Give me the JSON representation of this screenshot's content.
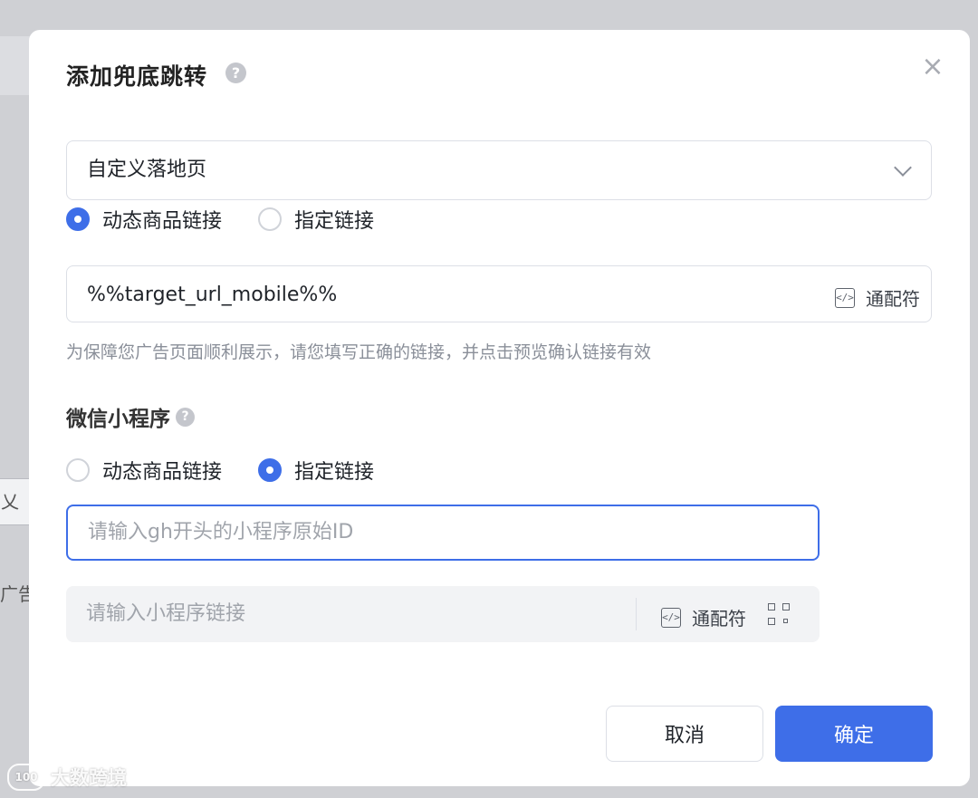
{
  "dialog": {
    "title": "添加兜底跳转",
    "help_glyph": "?",
    "close_glyph": "×"
  },
  "landing_select": {
    "value": "自定义落地页"
  },
  "h5_link_type": {
    "options": [
      {
        "label": "动态商品链接",
        "selected": true
      },
      {
        "label": "指定链接",
        "selected": false
      }
    ]
  },
  "url_input": {
    "value": "%%target_url_mobile%%",
    "wildcard_label": "通配符",
    "code_glyph": "</>"
  },
  "hint": "为保障您广告页面顺利展示，请您填写正确的链接，并点击预览确认链接有效",
  "mini_program": {
    "section_title": "微信小程序",
    "options": [
      {
        "label": "动态商品链接",
        "selected": false
      },
      {
        "label": "指定链接",
        "selected": true
      }
    ],
    "appid_placeholder": "请输入gh开头的小程序原始ID",
    "link_placeholder": "请输入小程序链接",
    "wildcard_label": "通配符"
  },
  "buttons": {
    "cancel": "取消",
    "confirm": "确定"
  },
  "background": {
    "card_text": "乂",
    "side_text": "广告"
  },
  "watermark": {
    "logo_text": "100",
    "text": "大数跨境"
  },
  "colors": {
    "primary": "#3e6ee8",
    "placeholder": "#a0a4ab",
    "hint": "#8a8f99"
  }
}
